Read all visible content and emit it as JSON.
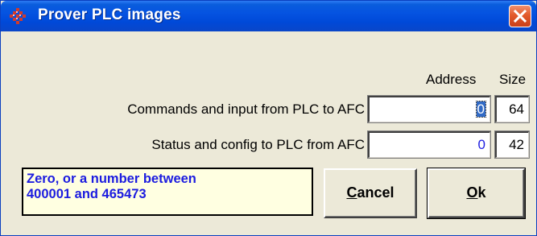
{
  "window": {
    "title": "Prover PLC images",
    "app_icon": "prover-app-icon",
    "close_icon": "close-icon",
    "colors": {
      "titlebar": "#0553e1",
      "close": "#e35a2a",
      "face": "#ece9d8",
      "hint_bg": "#ffffe1",
      "value_text": "#1c1ce0"
    }
  },
  "headers": {
    "address": "Address",
    "size": "Size"
  },
  "rows": [
    {
      "label": "Commands and input from PLC to AFC",
      "address": "0",
      "size": "64"
    },
    {
      "label": "Status and config to PLC from AFC",
      "address": "0",
      "size": "42"
    }
  ],
  "hint": {
    "line1": "Zero, or a number between",
    "line2": "400001 and 465473"
  },
  "buttons": {
    "cancel_mnemonic": "C",
    "cancel_rest": "ancel",
    "ok_mnemonic": "O",
    "ok_rest": "k"
  }
}
